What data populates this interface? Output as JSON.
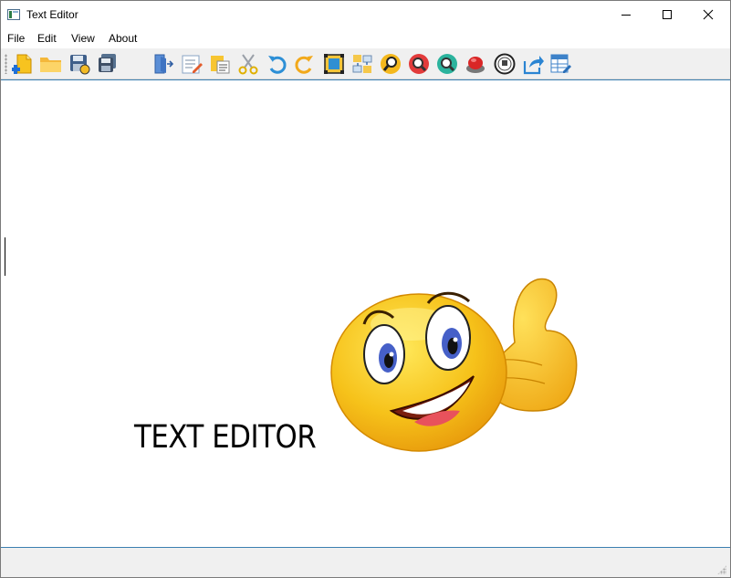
{
  "window": {
    "title": "Text Editor"
  },
  "menu": [
    "File",
    "Edit",
    "View",
    "About"
  ],
  "toolbar": {
    "icons": [
      "new-file-icon",
      "open-folder-icon",
      "save-icon",
      "save-as-icon",
      "exit-icon",
      "edit-icon",
      "paste-icon",
      "cut-icon",
      "undo-icon",
      "redo-icon",
      "select-all-icon",
      "replace-icon",
      "find-icon",
      "zoom-in-icon",
      "zoom-out-icon",
      "stop-icon",
      "library-icon",
      "share-icon",
      "table-edit-icon"
    ]
  },
  "editor": {
    "heading": "TEXT EDITOR",
    "image": "thumbs-up-smiley"
  },
  "colors": {
    "accent": "#3c7fb1",
    "toolbar_bg": "#f0f0f0",
    "smiley_yellow": "#f6c21a"
  }
}
